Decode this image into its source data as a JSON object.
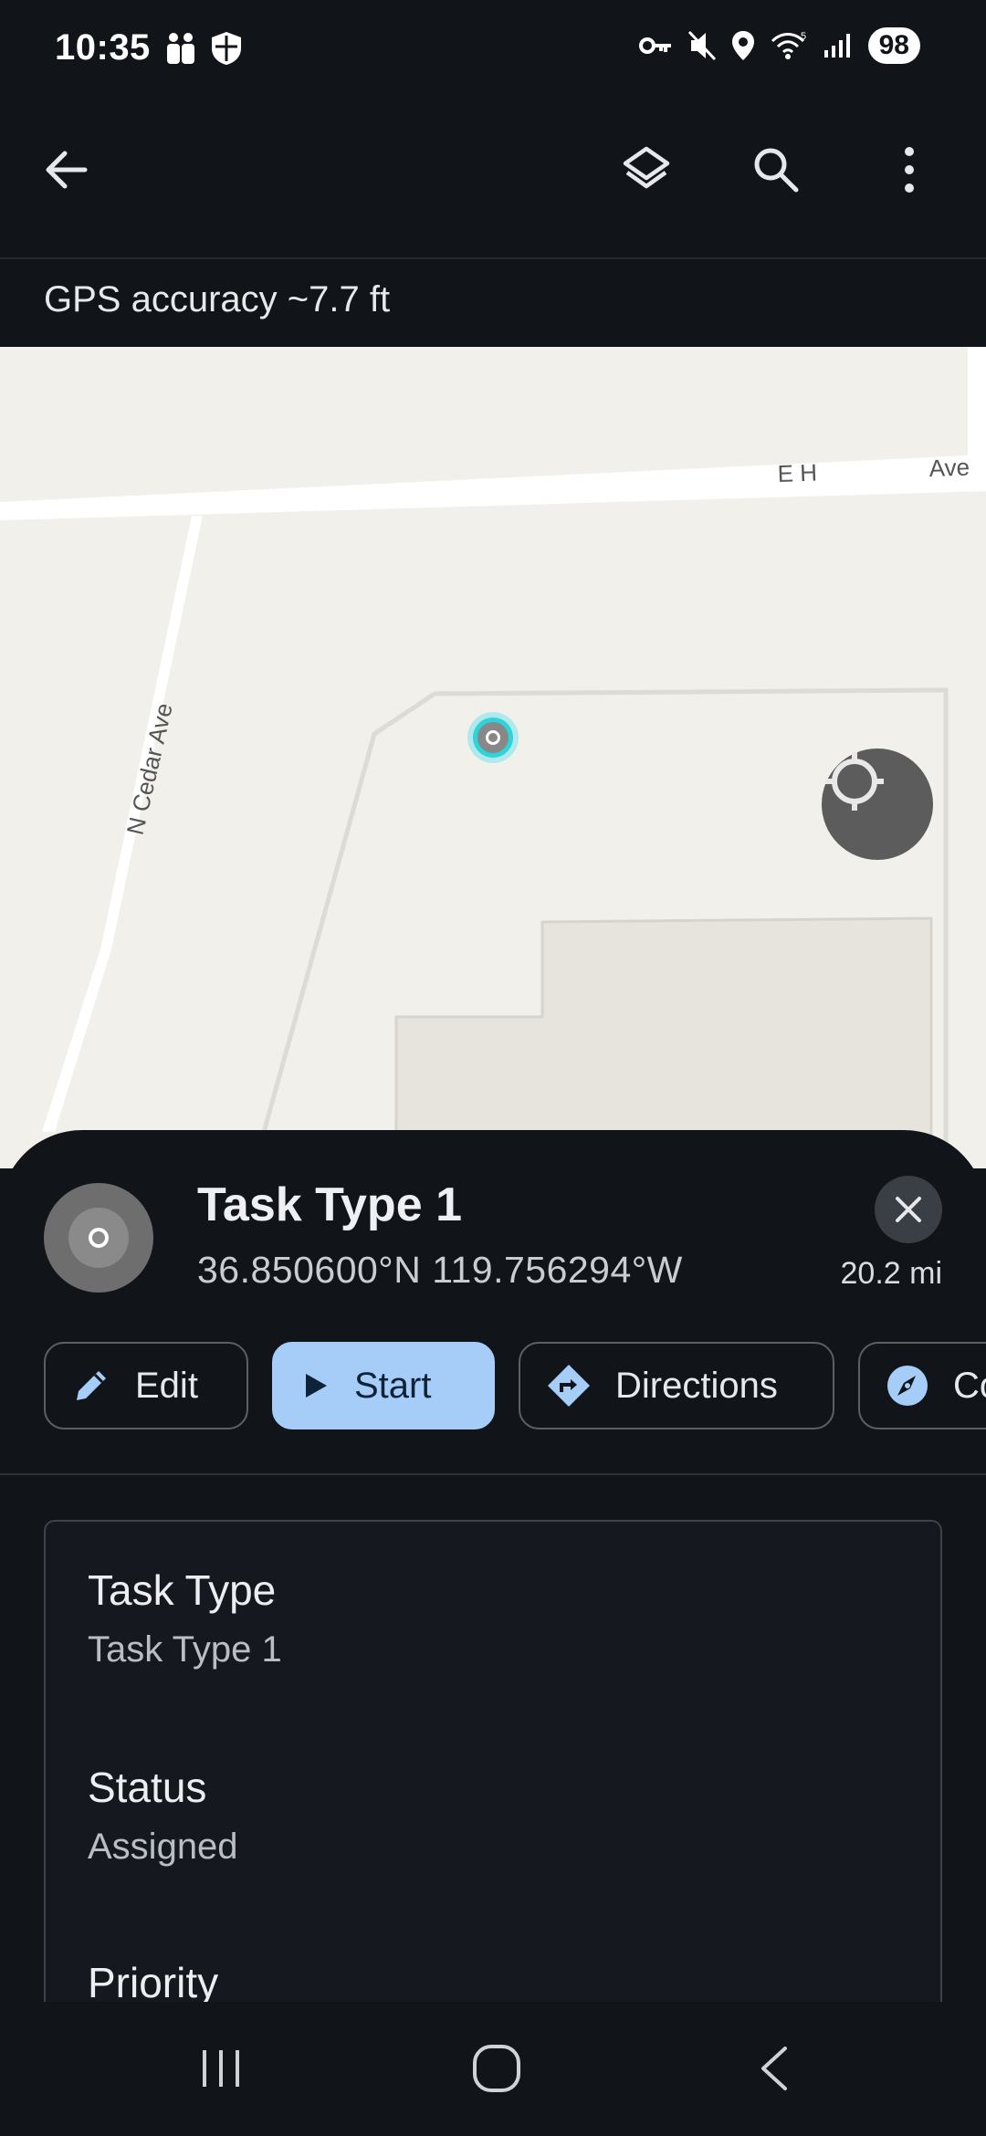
{
  "status_bar": {
    "time": "10:35",
    "battery": "98",
    "icons": [
      "family-icon",
      "shield-icon",
      "key-icon",
      "mute-icon",
      "location-pin-icon",
      "wifi-icon",
      "signal-icon"
    ]
  },
  "app_bar": {
    "icons": [
      "back-arrow-icon",
      "layers-icon",
      "search-icon",
      "more-vert-icon"
    ]
  },
  "gps": {
    "text": "GPS accuracy ~7.7 ft"
  },
  "map": {
    "street_labels": [
      "E H",
      "Ave",
      "N Cedar Ave"
    ],
    "colors": {
      "background": "#f1f0eb",
      "road": "#ffffff",
      "building": "#e6e4dd",
      "accent": "#a6cdf8"
    }
  },
  "task": {
    "title": "Task Type 1",
    "coordinates": "36.850600°N  119.756294°W",
    "distance": "20.2 mi"
  },
  "actions": [
    {
      "label": "Edit",
      "icon": "pencil-icon"
    },
    {
      "label": "Start",
      "icon": "play-icon"
    },
    {
      "label": "Directions",
      "icon": "directions-icon"
    },
    {
      "label": "Co",
      "icon": "compass-icon"
    }
  ],
  "details": [
    {
      "label": "Task Type",
      "value": "Task Type 1"
    },
    {
      "label": "Status",
      "value": "Assigned"
    },
    {
      "label": "Priority",
      "value": ""
    }
  ]
}
